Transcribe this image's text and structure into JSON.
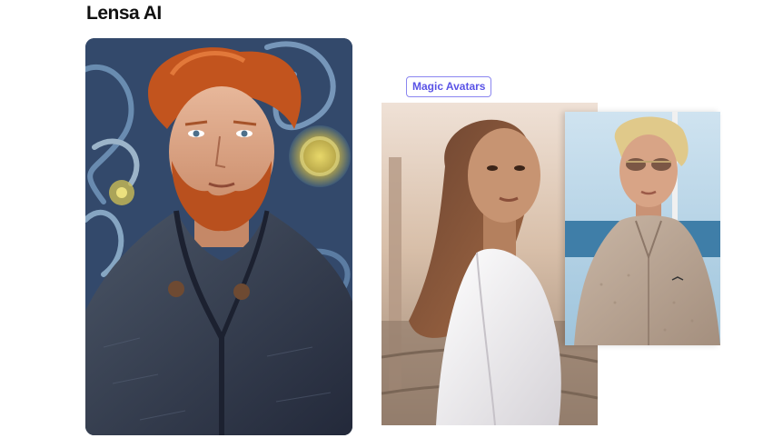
{
  "page": {
    "title": "Lensa AI"
  },
  "badge": {
    "label": "Magic Avatars",
    "color": "#5a53e6"
  },
  "images": [
    {
      "name": "van-gogh-style-portrait"
    },
    {
      "name": "woman-white-dress-portrait"
    },
    {
      "name": "blond-man-sunglasses-portrait"
    }
  ]
}
